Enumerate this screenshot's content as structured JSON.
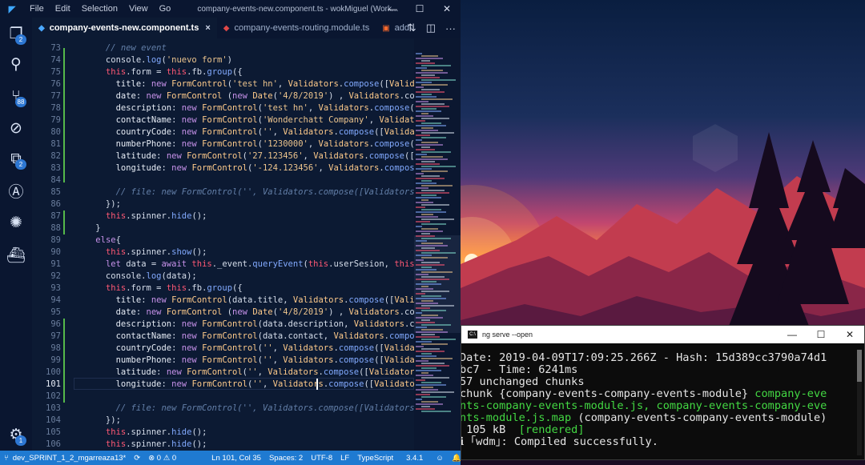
{
  "vscode": {
    "menu": [
      "File",
      "Edit",
      "Selection",
      "View",
      "Go"
    ],
    "window_title": "company-events-new.component.ts - wokMiguel (Work...",
    "tabs": [
      {
        "label": "company-events-new.component.ts",
        "icon": "angular-icon",
        "active": true,
        "close": "×"
      },
      {
        "label": "company-events-routing.module.ts",
        "icon": "angular-icon",
        "active": false
      },
      {
        "label": "add-",
        "icon": "html5-icon",
        "active": false
      }
    ],
    "activity_badges": {
      "explorer": "2",
      "source_control": "88",
      "extensions": "2",
      "settings": "1"
    },
    "code_lines": [
      {
        "n": "73",
        "text": "      // new event",
        "type": "comment"
      },
      {
        "n": "74",
        "text": "      console.log('nuevo form')"
      },
      {
        "n": "75",
        "text": "      this.form = this.fb.group({"
      },
      {
        "n": "76",
        "text": "        title: new FormControl('test hn', Validators.compose([Validators"
      },
      {
        "n": "77",
        "text": "        date: new FormControl (new Date('4/8/2019') , Validators.compose"
      },
      {
        "n": "78",
        "text": "        description: new FormControl('test hn', Validators.compose([Vali"
      },
      {
        "n": "79",
        "text": "        contactName: new FormControl('Wonderchatt Company', Validators.c"
      },
      {
        "n": "80",
        "text": "        countryCode: new FormControl('', Validators.compose([Validators."
      },
      {
        "n": "81",
        "text": "        numberPhone: new FormControl('1230000', Validators.compose([Vali"
      },
      {
        "n": "82",
        "text": "        latitude: new FormControl('27.123456', Validators.compose([Valic"
      },
      {
        "n": "83",
        "text": "        longitude: new FormControl('-124.123456', Validators.compose([Va"
      },
      {
        "n": "84",
        "text": ""
      },
      {
        "n": "85",
        "text": "        // file: new FormControl('', Validators.compose([Validators.requ",
        "type": "comment"
      },
      {
        "n": "86",
        "text": "      });"
      },
      {
        "n": "87",
        "text": "      this.spinner.hide();"
      },
      {
        "n": "88",
        "text": "    }"
      },
      {
        "n": "89",
        "text": "    else{"
      },
      {
        "n": "90",
        "text": "      this.spinner.show();"
      },
      {
        "n": "91",
        "text": "      let data = await this._event.queryEvent(this.userSesion, this.idEv"
      },
      {
        "n": "92",
        "text": "      console.log(data);"
      },
      {
        "n": "93",
        "text": "      this.form = this.fb.group({"
      },
      {
        "n": "94",
        "text": "        title: new FormControl(data.title, Validators.compose([Validators"
      },
      {
        "n": "95",
        "text": "        date: new FormControl (new Date('4/8/2019') , Validators.compose"
      },
      {
        "n": "96",
        "text": "        description: new FormControl(data.description, Validators.compos"
      },
      {
        "n": "97",
        "text": "        contactName: new FormControl(data.contact, Validators.compose([V"
      },
      {
        "n": "98",
        "text": "        countryCode: new FormControl('', Validators.compose([Validators."
      },
      {
        "n": "99",
        "text": "        numberPhone: new FormControl('', Validators.compose([Validators."
      },
      {
        "n": "100",
        "text": "        latitude: new FormControl('', Validators.compose([Validators.req"
      },
      {
        "n": "101",
        "text": "        longitude: new FormControl('', Validators.compose([Validators.re",
        "current": true
      },
      {
        "n": "102",
        "text": ""
      },
      {
        "n": "103",
        "text": "        // file: new FormControl('', Validators.compose([Validators.requ",
        "type": "comment"
      },
      {
        "n": "104",
        "text": "      });"
      },
      {
        "n": "105",
        "text": "      this.spinner.hide();"
      },
      {
        "n": "106",
        "text": "      this.spinner.hide();"
      }
    ],
    "statusbar": {
      "branch": "dev_SPRINT_1_2_mgarreaza13*",
      "sync": "⟳",
      "problems": "⊗ 0 ⚠ 0",
      "cursor": "Ln 101, Col 35",
      "spaces": "Spaces: 2",
      "encoding": "UTF-8",
      "eol": "LF",
      "language": "TypeScript",
      "ts_version": "3.4.1",
      "feedback": "☺",
      "bell": "🔔"
    }
  },
  "terminal": {
    "title": "ng serve --open",
    "lines": [
      {
        "text": "Date: 2019-04-09T17:09:25.266Z - Hash: 15d389cc3790a74d1"
      },
      {
        "text": "bc7 - Time: 6241ms"
      },
      {
        "text": "57 unchanged chunks"
      },
      {
        "text": "chunk {company-events-company-events-module} ",
        "green": "company-eve"
      },
      {
        "green": "nts-company-events-module.js, company-events-company-eve"
      },
      {
        "green": "nts-module.js.map",
        "text": " (company-events-company-events-module)"
      },
      {
        "text": " 105 kB  ",
        "green": "[rendered]"
      },
      {
        "text": "ℹ ｢wdm｣: Compiled successfully."
      }
    ]
  }
}
